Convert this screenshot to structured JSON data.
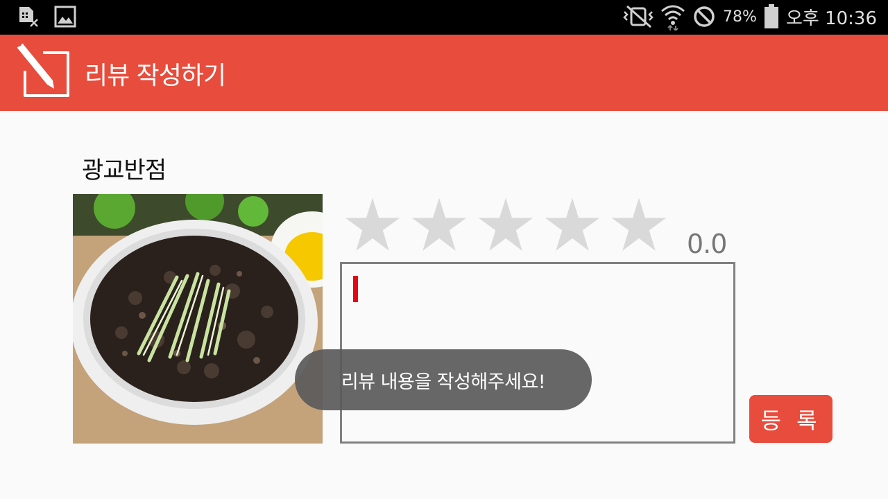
{
  "status_bar": {
    "left_icons": [
      "sim-card-x-icon",
      "image-icon"
    ],
    "right_icons": [
      "vibrate-mute-icon",
      "wifi-icon",
      "do-not-disturb-icon",
      "battery-icon"
    ],
    "battery_percent": "78%",
    "time": "오후 10:36"
  },
  "app_bar": {
    "title": "리뷰 작성하기",
    "icon": "edit-pencil-icon",
    "color": "#e74c3c"
  },
  "restaurant": {
    "name": "광교반점"
  },
  "rating": {
    "stars_total": 5,
    "stars_filled": 0,
    "value": "0.0",
    "star_color": "#d9d9d9"
  },
  "review": {
    "value": "",
    "caret_color": "#e30613"
  },
  "submit": {
    "label": "등 록",
    "color": "#e74c3c"
  },
  "toast": {
    "message": "리뷰 내용을 작성해주세요!"
  }
}
